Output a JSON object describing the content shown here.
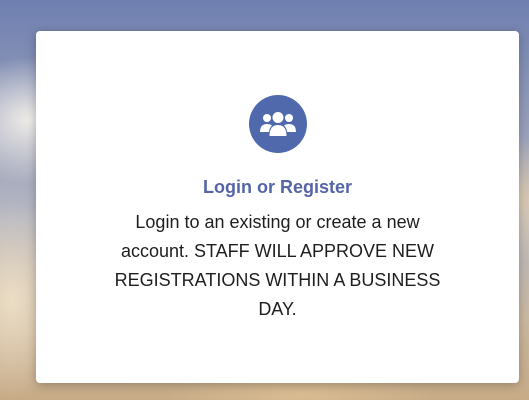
{
  "card": {
    "icon": "users-icon",
    "title": "Login or Register",
    "description": "Login to an existing or create a new account. STAFF WILL APPROVE NEW REGISTRATIONS WITHIN A BUSINESS DAY."
  },
  "colors": {
    "accent": "#4f69ac",
    "title": "#5565a7",
    "text": "#1e1e1e"
  }
}
